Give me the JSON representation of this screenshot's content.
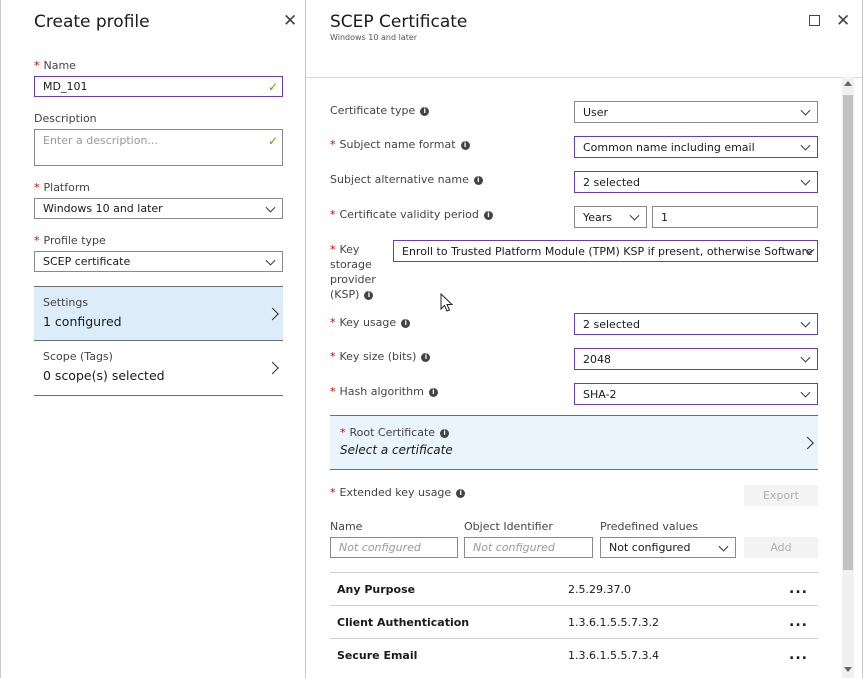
{
  "left": {
    "title": "Create profile",
    "name_label": "Name",
    "name_value": "MD_101",
    "description_label": "Description",
    "description_placeholder": "Enter a description...",
    "platform_label": "Platform",
    "platform_value": "Windows 10 and later",
    "profile_type_label": "Profile type",
    "profile_type_value": "SCEP certificate",
    "settings_title": "Settings",
    "settings_value": "1 configured",
    "scope_title": "Scope (Tags)",
    "scope_value": "0 scope(s) selected"
  },
  "right": {
    "title": "SCEP Certificate",
    "subtitle": "Windows 10 and later",
    "certificate_type_label": "Certificate type",
    "certificate_type_value": "User",
    "subject_name_format_label": "Subject name format",
    "subject_name_format_value": "Common name including email",
    "subject_alt_name_label": "Subject alternative name",
    "subject_alt_name_value": "2 selected",
    "validity_label": "Certificate validity period",
    "validity_unit": "Years",
    "validity_value": "1",
    "ksp_label_1": "Key",
    "ksp_label_2": "storage",
    "ksp_label_3": "provider",
    "ksp_label_4": "(KSP)",
    "ksp_value": "Enroll to Trusted Platform Module (TPM) KSP if present, otherwise Software KSP",
    "key_usage_label": "Key usage",
    "key_usage_value": "2 selected",
    "key_size_label": "Key size (bits)",
    "key_size_value": "2048",
    "hash_label": "Hash algorithm",
    "hash_value": "SHA-2",
    "root_cert_title": "Root Certificate",
    "root_cert_value": "Select a certificate",
    "eku_label": "Extended key usage",
    "export_label": "Export",
    "col_name": "Name",
    "col_oid": "Object Identifier",
    "col_predef": "Predefined values",
    "name_placeholder": "Not configured",
    "oid_placeholder": "Not configured",
    "predef_value": "Not configured",
    "add_label": "Add",
    "rows": [
      {
        "name": "Any Purpose",
        "oid": "2.5.29.37.0",
        "menu": "..."
      },
      {
        "name": "Client Authentication",
        "oid": "1.3.6.1.5.5.7.3.2",
        "menu": "..."
      },
      {
        "name": "Secure Email",
        "oid": "1.3.6.1.5.5.7.3.4",
        "menu": "..."
      }
    ]
  },
  "icons": {
    "close": "✕",
    "check": "✓",
    "info": "i"
  },
  "colors": {
    "accent_purple": "#6b3fa0",
    "selected_nav": "#dcecf9",
    "required": "#cc0000",
    "valid_check": "#5aa600"
  }
}
